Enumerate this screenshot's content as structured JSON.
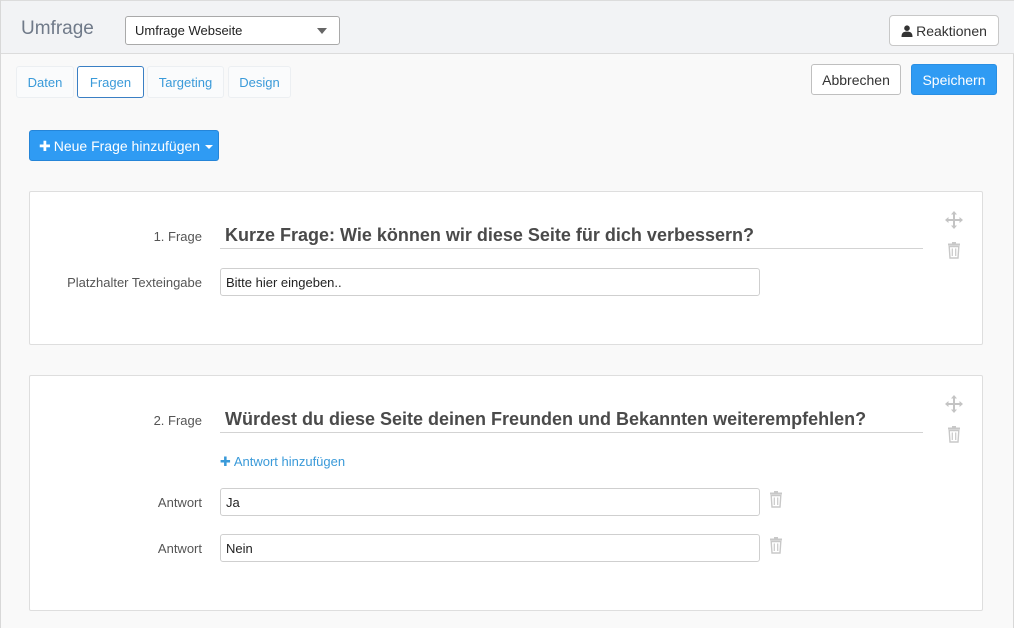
{
  "header": {
    "title": "Umfrage",
    "survey_select": "Umfrage Webseite",
    "reactions_label": "Reaktionen"
  },
  "tabs": [
    {
      "label": "Daten"
    },
    {
      "label": "Fragen",
      "active": true
    },
    {
      "label": "Targeting"
    },
    {
      "label": "Design"
    }
  ],
  "actions": {
    "cancel_label": "Abbrechen",
    "save_label": "Speichern",
    "add_question_label": "Neue Frage hinzufügen"
  },
  "questions": [
    {
      "number_label": "1. Frage",
      "title": "Kurze Frage: Wie können wir diese Seite für dich verbessern?",
      "placeholder_label": "Platzhalter Texteingabe",
      "placeholder_value": "Bitte hier eingeben.."
    },
    {
      "number_label": "2. Frage",
      "title": "Würdest du diese Seite deinen Freunden und Bekannten weiterempfehlen?",
      "add_answer_label": "Antwort hinzufügen",
      "answers": [
        {
          "label": "Antwort",
          "value": "Ja"
        },
        {
          "label": "Antwort",
          "value": "Nein"
        }
      ]
    }
  ],
  "colors": {
    "accent": "#2f9bf3",
    "link": "#3a9ad9",
    "icon_gray": "#c4c4c4"
  },
  "icons": {
    "move": "move-icon",
    "delete": "trash-icon",
    "user": "user-icon",
    "plus": "plus-icon"
  }
}
